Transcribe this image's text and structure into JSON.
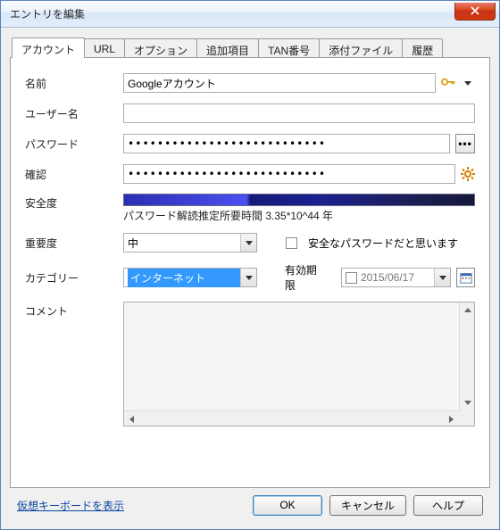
{
  "window": {
    "title": "エントリを編集"
  },
  "tabs": [
    {
      "label": "アカウント"
    },
    {
      "label": "URL"
    },
    {
      "label": "オプション"
    },
    {
      "label": "追加項目"
    },
    {
      "label": "TAN番号"
    },
    {
      "label": "添付ファイル"
    },
    {
      "label": "履歴"
    }
  ],
  "labels": {
    "name": "名前",
    "username": "ユーザー名",
    "password": "パスワード",
    "confirm": "確認",
    "strength": "安全度",
    "importance": "重要度",
    "category": "カテゴリー",
    "safe_password_checkbox": "安全なパスワードだと思います",
    "expiry": "有効期限",
    "comment": "コメント"
  },
  "values": {
    "name": "Googleアカウント",
    "username": "",
    "password": "•••••••••••••••••••••••••••",
    "confirm": "•••••••••••••••••••••••••••",
    "strength_text": "パスワード解読推定所要時間 3.35*10^44 年",
    "importance": "中",
    "category": "インターネット",
    "safe_password_checked": false,
    "expiry_date": "2015/06/17",
    "expiry_checked": false,
    "comment": ""
  },
  "footer": {
    "virtual_keyboard": "仮想キーボードを表示",
    "ok": "OK",
    "cancel": "キャンセル",
    "help": "ヘルプ"
  },
  "icons": {
    "reveal": "•••",
    "key": "key-icon",
    "gear": "gear-icon",
    "calendar": "calendar-icon",
    "close": "close-icon"
  }
}
